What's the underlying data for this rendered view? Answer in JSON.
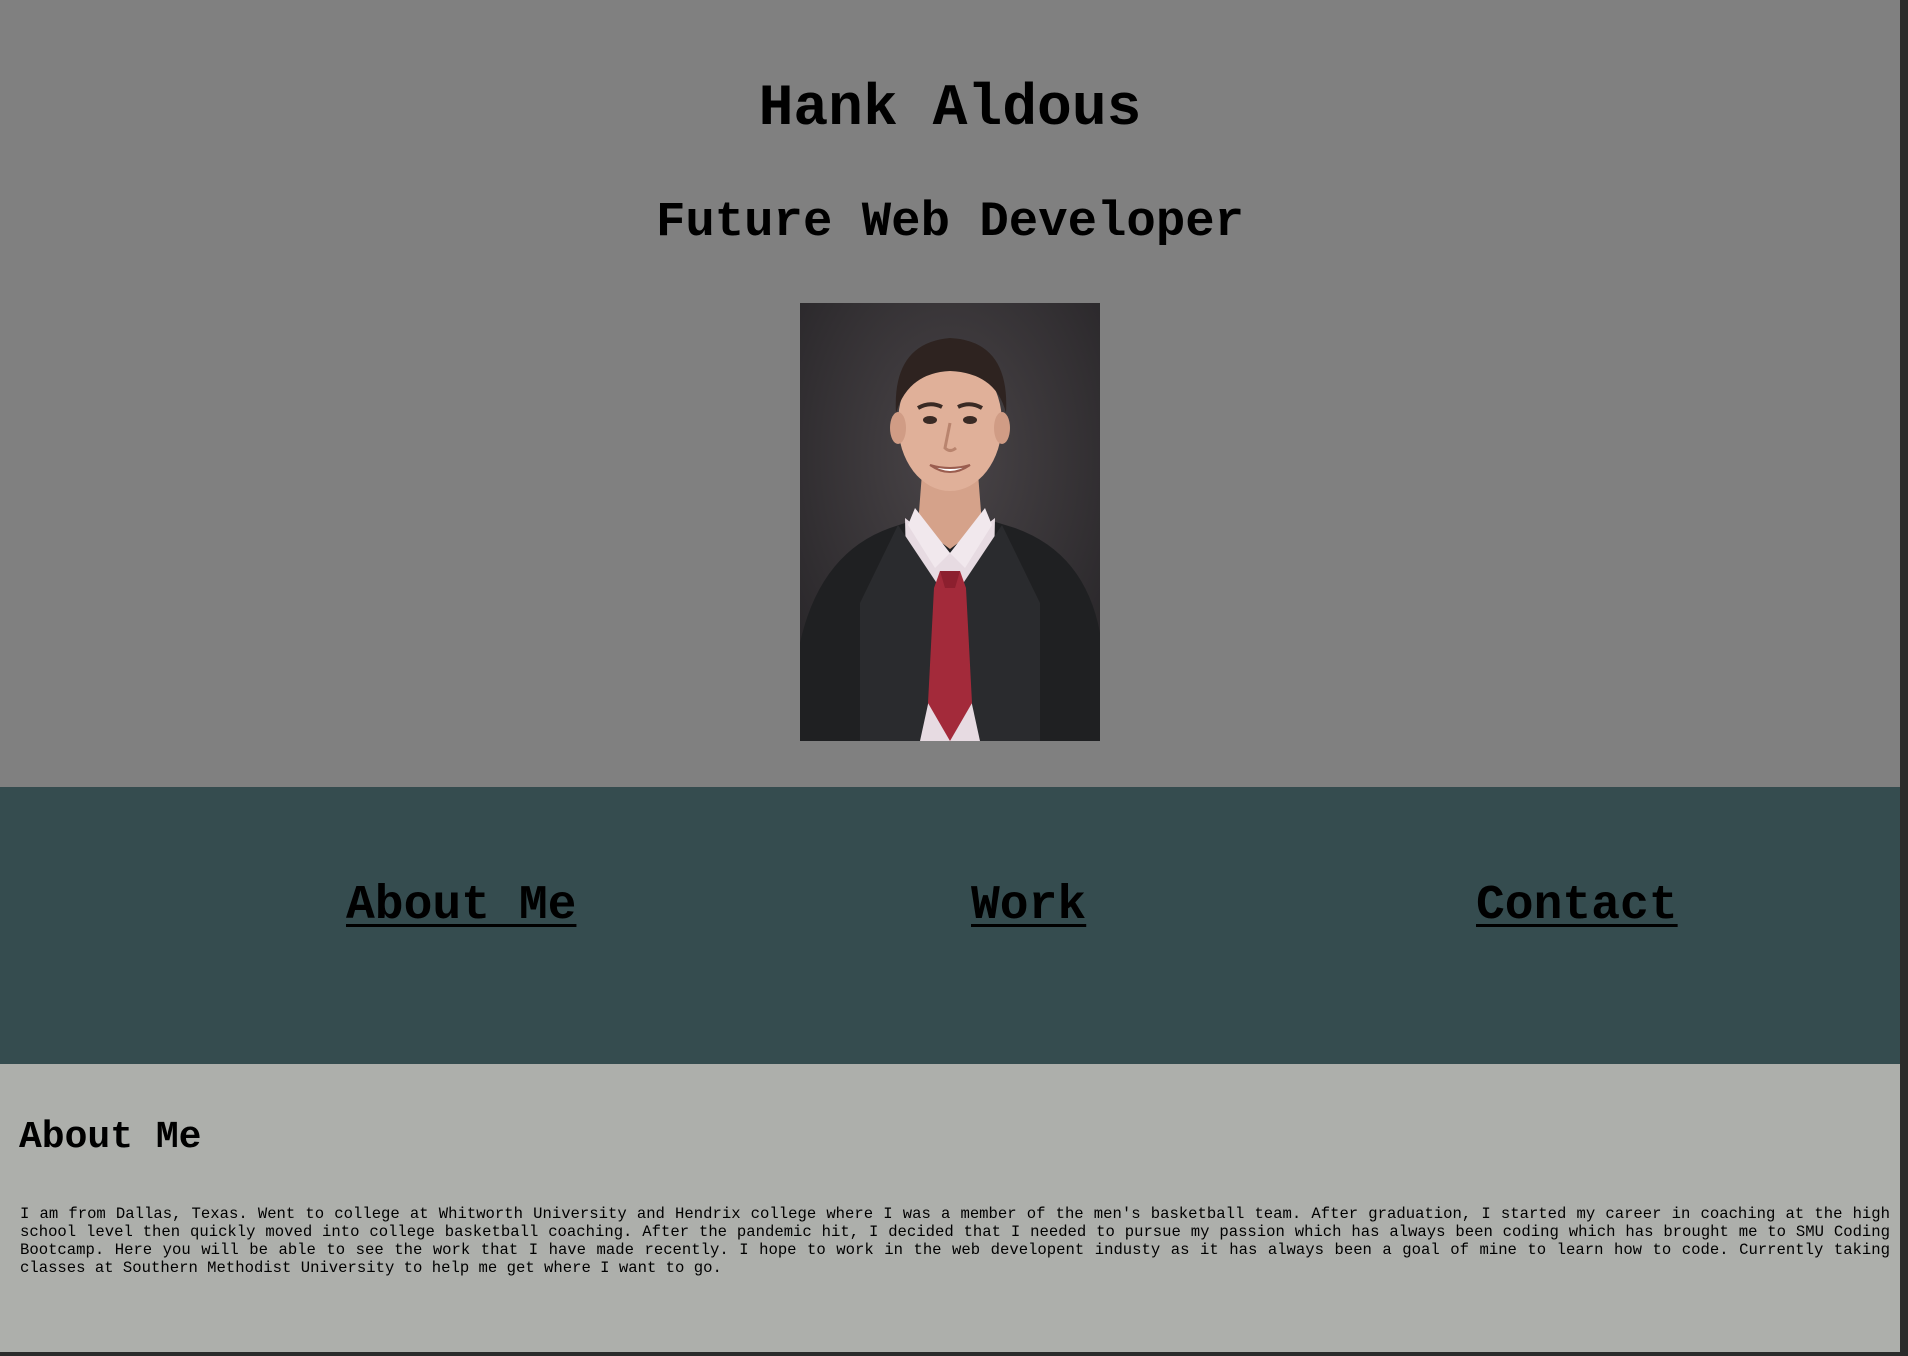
{
  "header": {
    "name": "Hank Aldous",
    "role": "Future Web Developer",
    "portrait_icon": "portrait-photo"
  },
  "nav": {
    "items": [
      {
        "label": "About Me"
      },
      {
        "label": "Work"
      },
      {
        "label": "Contact"
      }
    ]
  },
  "about": {
    "title": "About Me",
    "text": "I am from Dallas, Texas. Went to college at Whitworth University and Hendrix college where I was a member of the men's basketball team. After graduation, I started my career in coaching at the high school level then quickly moved into college basketball coaching. After the pandemic hit, I decided that I needed to pursue my passion which has always been coding which has brought me to SMU Coding Bootcamp. Here you will be able to see the work that I have made recently. I hope to work in the web developent industy as it has always been a goal of mine to learn how to code. Currently taking classes at Southern Methodist University to help me get where I want to go."
  },
  "colors": {
    "header_bg": "#808080",
    "nav_bg": "#354c4f",
    "about_bg": "#adafab",
    "text": "#000000"
  }
}
